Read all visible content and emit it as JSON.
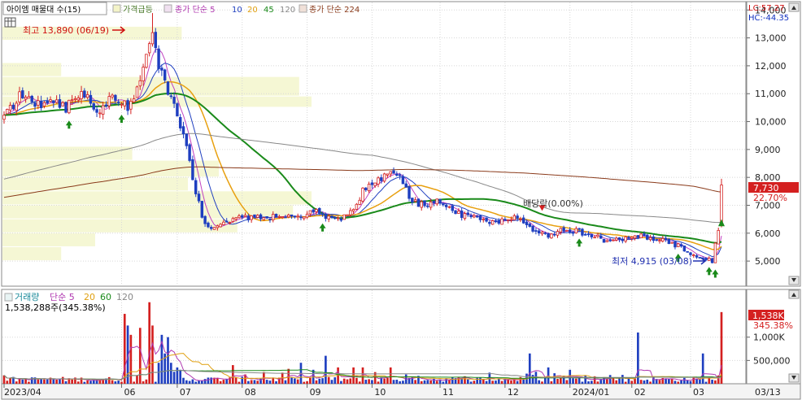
{
  "header": {
    "title": "아이엠 매물대 수(15)",
    "items": [
      {
        "label": "가격급등",
        "color": "#4a7a2a"
      },
      {
        "label": "종가 단순 5",
        "color": "#b038b0"
      },
      {
        "label": "10",
        "color": "#2040c0"
      },
      {
        "label": "20",
        "color": "#e0a010"
      },
      {
        "label": "45",
        "color": "#1a8a1a"
      },
      {
        "label": "120",
        "color": "#888888"
      },
      {
        "label": "종가 단순 224",
        "color": "#8a3a1a"
      }
    ],
    "right_tags": [
      {
        "label": "LC:57.27",
        "color": "#d01010"
      },
      {
        "label": "HC:-44.35",
        "color": "#1030c0"
      }
    ]
  },
  "volume_header": {
    "items": [
      {
        "label": "거래량",
        "color": "#1a8a9a"
      },
      {
        "label": "단순 5",
        "color": "#b038b0"
      },
      {
        "label": "20",
        "color": "#e0a010"
      },
      {
        "label": "60",
        "color": "#1a8a1a"
      },
      {
        "label": "120",
        "color": "#888888"
      }
    ],
    "volume_text": "1,538,288주(345.38%)"
  },
  "annotations": {
    "high": "최고 13,890 (06/19)",
    "low": "최저 4,915 (03/08)",
    "dividend": "배당락(0.00%)"
  },
  "chart_data": [
    {
      "type": "candlestick",
      "title": "아이엠 매물대 수(15)",
      "x_labels": [
        "2023/04",
        "06",
        "07",
        "08",
        "09",
        "10",
        "11",
        "12",
        "2024/01",
        "02",
        "03",
        "03/13"
      ],
      "y_ticks": [
        5000,
        6000,
        7000,
        8000,
        9000,
        10000,
        11000,
        12000,
        13000,
        14000
      ],
      "y_tick_labels": [
        "5,000",
        "6,000",
        "7,000",
        "8,000",
        "9,000",
        "10,000",
        "11,000",
        "12,000",
        "13,000",
        "14,000"
      ],
      "ylim": [
        4100,
        14300
      ],
      "last_price": "7,730",
      "last_change": "22.70%",
      "high": {
        "value": 13890,
        "date": "06/19"
      },
      "low": {
        "value": 4915,
        "date": "03/08"
      },
      "up_color": "#d42020",
      "down_color": "#1f3fc0",
      "anchors": [
        [
          0,
          10200
        ],
        [
          5,
          10900
        ],
        [
          10,
          10600
        ],
        [
          16,
          10800
        ],
        [
          20,
          10500
        ],
        [
          26,
          11000
        ],
        [
          30,
          10400
        ],
        [
          36,
          10900
        ],
        [
          40,
          10500
        ],
        [
          44,
          11500
        ],
        [
          46,
          12600
        ],
        [
          48,
          13100
        ],
        [
          50,
          12000
        ],
        [
          53,
          11000
        ],
        [
          56,
          10300
        ],
        [
          58,
          9500
        ],
        [
          60,
          8500
        ],
        [
          62,
          7400
        ],
        [
          65,
          6300
        ],
        [
          68,
          6150
        ],
        [
          72,
          6400
        ],
        [
          78,
          6600
        ],
        [
          82,
          6550
        ],
        [
          90,
          6600
        ],
        [
          96,
          6500
        ],
        [
          100,
          6800
        ],
        [
          104,
          6600
        ],
        [
          108,
          6500
        ],
        [
          112,
          6700
        ],
        [
          116,
          7500
        ],
        [
          120,
          7800
        ],
        [
          124,
          8100
        ],
        [
          128,
          8000
        ],
        [
          131,
          7300
        ],
        [
          134,
          7000
        ],
        [
          140,
          7100
        ],
        [
          146,
          6700
        ],
        [
          152,
          6600
        ],
        [
          158,
          6400
        ],
        [
          164,
          6600
        ],
        [
          170,
          6200
        ],
        [
          176,
          5950
        ],
        [
          182,
          6150
        ],
        [
          188,
          6000
        ],
        [
          194,
          5750
        ],
        [
          200,
          5800
        ],
        [
          206,
          5900
        ],
        [
          212,
          5750
        ],
        [
          218,
          5550
        ],
        [
          223,
          5250
        ],
        [
          226,
          5100
        ],
        [
          229,
          5000
        ],
        [
          231,
          6100
        ],
        [
          232,
          7730
        ]
      ],
      "moving_averages": [
        {
          "name": "5",
          "color": "#c040c0",
          "period": 5
        },
        {
          "name": "10",
          "color": "#2040c0",
          "period": 10
        },
        {
          "name": "20",
          "color": "#e8a010",
          "period": 20
        },
        {
          "name": "45",
          "color": "#1a8a1a",
          "period": 45
        },
        {
          "name": "120",
          "color": "#888888",
          "period": 120
        },
        {
          "name": "224",
          "color": "#8a3a1a",
          "period": 224
        }
      ],
      "volume_profile": [
        {
          "range": [
            12900,
            13400
          ],
          "level": 0.58
        },
        {
          "range": [
            11600,
            12100
          ],
          "level": 0.19
        },
        {
          "range": [
            10900,
            11600
          ],
          "level": 0.96
        },
        {
          "range": [
            10500,
            10900
          ],
          "level": 1.0
        },
        {
          "range": [
            8600,
            9100
          ],
          "level": 0.42
        },
        {
          "range": [
            8000,
            8600
          ],
          "level": 0.7
        },
        {
          "range": [
            7500,
            8000
          ],
          "level": 0.6
        },
        {
          "range": [
            7000,
            7500
          ],
          "level": 1.0
        },
        {
          "range": [
            6500,
            7000
          ],
          "level": 0.94
        },
        {
          "range": [
            6000,
            6500
          ],
          "level": 0.76
        },
        {
          "range": [
            5500,
            6000
          ],
          "level": 0.3
        },
        {
          "range": [
            5000,
            5500
          ],
          "level": 0.19
        }
      ],
      "green_arrows": [
        21,
        38,
        103,
        186,
        218
      ],
      "dividend_index": 174
    },
    {
      "type": "bar",
      "title": "거래량",
      "y_ticks": [
        500000,
        1000000
      ],
      "y_tick_labels": [
        "500,000",
        "1,000K"
      ],
      "ylim": [
        0,
        1850000
      ],
      "last_volume": "1,538K",
      "last_ratio": "345.38%",
      "spikes": [
        [
          39,
          1500000
        ],
        [
          40,
          1250000
        ],
        [
          41,
          1050000
        ],
        [
          44,
          1200000
        ],
        [
          47,
          1750000
        ],
        [
          48,
          1250000
        ],
        [
          50,
          450000
        ],
        [
          51,
          1050000
        ],
        [
          52,
          650000
        ],
        [
          53,
          1000000
        ],
        [
          54,
          450000
        ],
        [
          56,
          350000
        ],
        [
          57,
          300000
        ],
        [
          74,
          400000
        ],
        [
          78,
          200000
        ],
        [
          84,
          250000
        ],
        [
          92,
          320000
        ],
        [
          96,
          450000
        ],
        [
          100,
          300000
        ],
        [
          104,
          600000
        ],
        [
          108,
          350000
        ],
        [
          113,
          350000
        ],
        [
          116,
          350000
        ],
        [
          120,
          250000
        ],
        [
          125,
          350000
        ],
        [
          130,
          200000
        ],
        [
          170,
          650000
        ],
        [
          176,
          350000
        ],
        [
          183,
          300000
        ],
        [
          205,
          1100000
        ],
        [
          226,
          650000
        ],
        [
          232,
          1538288
        ]
      ]
    }
  ]
}
